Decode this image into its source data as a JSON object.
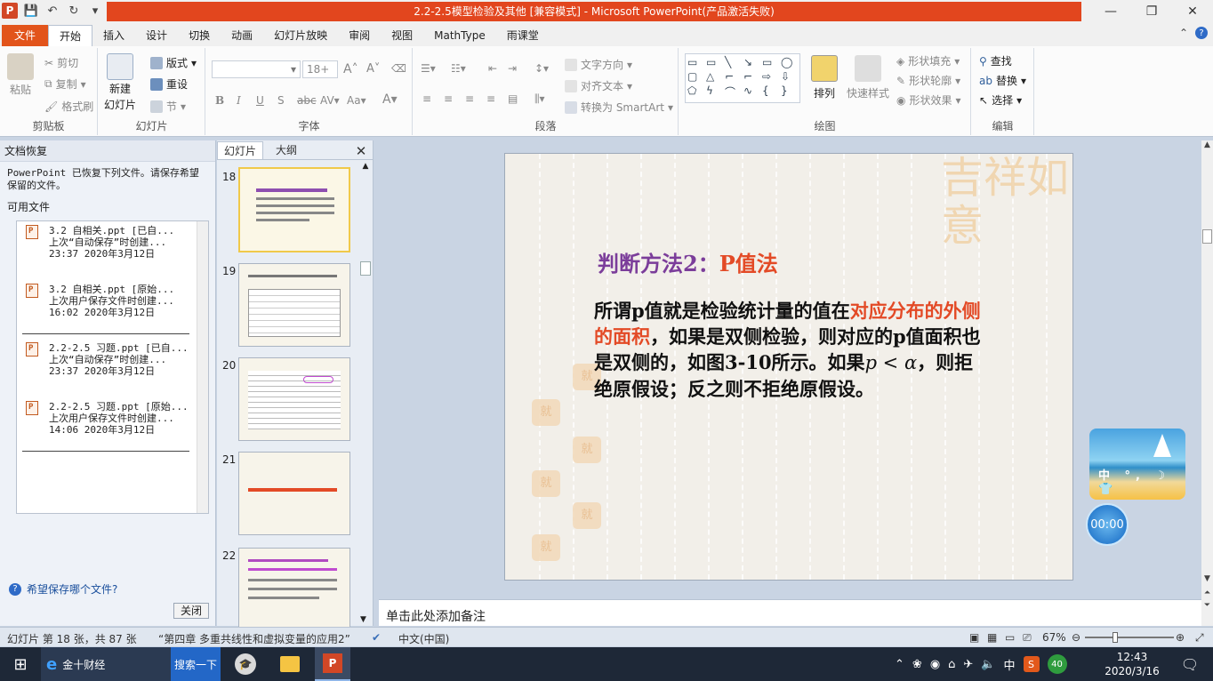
{
  "title_bar": {
    "title": "2.2-2.5模型检验及其他 [兼容模式] - Microsoft PowerPoint(产品激活失败)",
    "minimize": "—",
    "maximize": "❐",
    "close": "✕"
  },
  "tabs": [
    "文件",
    "开始",
    "插入",
    "设计",
    "切换",
    "动画",
    "幻灯片放映",
    "审阅",
    "视图",
    "MathType",
    "雨课堂"
  ],
  "ribbon": {
    "clipboard": {
      "label": "剪贴板",
      "paste": "粘贴",
      "cut": "剪切",
      "copy": "复制",
      "format_painter": "格式刷"
    },
    "slides": {
      "label": "幻灯片",
      "new_slide_line1": "新建",
      "new_slide_line2": "幻灯片",
      "layout": "版式",
      "reset": "重设",
      "section": "节"
    },
    "font": {
      "label": "字体",
      "size": "18+"
    },
    "paragraph": {
      "label": "段落",
      "text_direction": "文字方向",
      "align_text": "对齐文本",
      "smartart": "转换为 SmartArt"
    },
    "drawing": {
      "label": "绘图",
      "arrange": "排列",
      "quick_styles": "快速样式",
      "shape_fill": "形状填充",
      "shape_outline": "形状轮廓",
      "shape_effects": "形状效果"
    },
    "editing": {
      "label": "编辑",
      "find": "查找",
      "replace": "替换",
      "select": "选择"
    }
  },
  "recovery": {
    "header": "文档恢复",
    "message": "PowerPoint 已恢复下列文件。请保存希望保留的文件。",
    "available": "可用文件",
    "files": [
      {
        "name": "3.2  自相关.ppt  [已自...",
        "desc": "上次“自动保存”时创建...",
        "time": "23:37  2020年3月12日"
      },
      {
        "name": "3.2  自相关.ppt  [原始...",
        "desc": "上次用户保存文件时创建...",
        "time": "16:02  2020年3月12日"
      },
      {
        "name": "2.2-2.5 习题.ppt  [已自...",
        "desc": "上次“自动保存”时创建...",
        "time": "23:37  2020年3月12日"
      },
      {
        "name": "2.2-2.5 习题.ppt  [原始...",
        "desc": "上次用户保存文件时创建...",
        "time": "14:06  2020年3月12日"
      }
    ],
    "help_link": "希望保存哪个文件?",
    "close_button": "关闭"
  },
  "thumbnails": {
    "tab_slides": "幻灯片",
    "tab_outline": "大纲",
    "close": "✕",
    "items": [
      "18",
      "19",
      "20",
      "21",
      "22"
    ]
  },
  "slide": {
    "title_purple": "判断方法2：",
    "title_red": "P值法",
    "body_part1": "所谓p值就是检验统计量的值在",
    "body_red": "对应分布的外侧的面积",
    "body_part2": "，如果是双侧检验，则对应的p值面积也是双侧的，如图3-10所示。如果",
    "body_math": "p < α",
    "body_part3": "，则拒绝原假设；反之则不拒绝原假设。",
    "stamp_char": "就",
    "deco_text": "吉祥如意"
  },
  "notes_placeholder": "单击此处添加备注",
  "status": {
    "slide_info": "幻灯片 第 18 张，共 87 张",
    "theme": "“第四章 多重共线性和虚拟变量的应用2”",
    "language": "中文(中国)",
    "zoom": "67%"
  },
  "widget": {
    "beach_icons": "中 °, ☽ 👕",
    "timer": "00:00"
  },
  "taskbar": {
    "browser_label": "金十财经",
    "search_label": "搜索一下",
    "tray_ime": "中",
    "tray_badge": "40",
    "time": "12:43",
    "date": "2020/3/16"
  },
  "colors": {
    "file_tab": "#e2541b",
    "title_red": "#e2461e",
    "slide_title_purple": "#7b3d9a",
    "slide_red": "#e34a26"
  }
}
